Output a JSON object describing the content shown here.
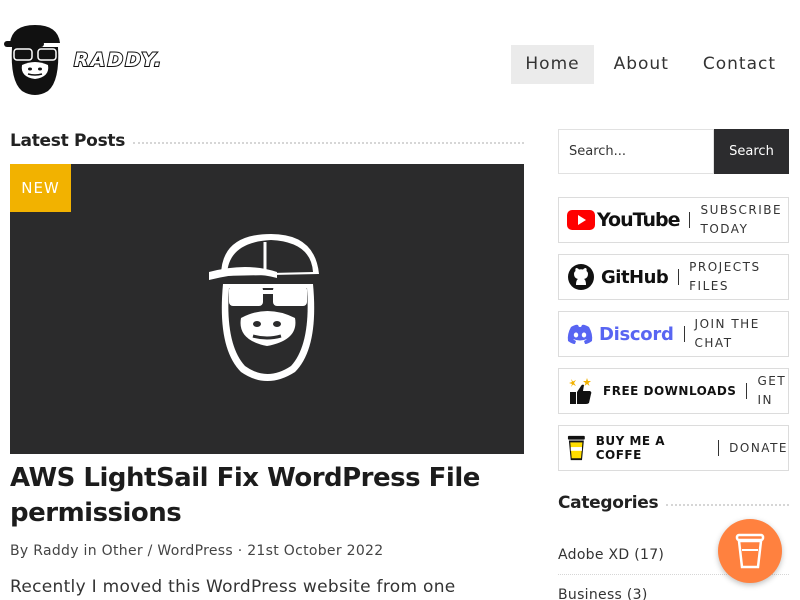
{
  "header": {
    "logo_text": "RADDY.",
    "nav": [
      {
        "label": "Home",
        "active": true
      },
      {
        "label": "About",
        "active": false
      },
      {
        "label": "Contact",
        "active": false
      }
    ]
  },
  "main": {
    "section_title": "Latest Posts",
    "hero_badge": "NEW",
    "post": {
      "title": "AWS LightSail Fix WordPress File permissions",
      "meta": "By Raddy in Other / WordPress · 21st October 2022",
      "excerpt": "Recently I moved this WordPress website from one"
    }
  },
  "sidebar": {
    "search": {
      "placeholder": "Search...",
      "button": "Search"
    },
    "promos": [
      {
        "brand": "YouTube",
        "cta_1": "SUBSCRIBE",
        "cta_2": "TODAY",
        "icon": "youtube-icon"
      },
      {
        "brand": "GitHub",
        "cta_1": "PROJECTS FILES",
        "cta_2": "",
        "icon": "github-icon"
      },
      {
        "brand": "Discord",
        "cta_1": "JOIN THE",
        "cta_2": "CHAT",
        "icon": "discord-icon"
      },
      {
        "brand": "FREE DOWNLOADS",
        "cta_1": "GET",
        "cta_2": "IN",
        "icon": "thumbs-up-icon"
      },
      {
        "brand": "BUY ME A COFFE",
        "cta_1": "DONATE",
        "cta_2": "",
        "icon": "coffee-cup-icon"
      }
    ],
    "categories_title": "Categories",
    "categories": [
      {
        "label": "Adobe XD (17)"
      },
      {
        "label": "Business (3)"
      }
    ]
  },
  "colors": {
    "badge": "#f2b200",
    "hero_bg": "#2b2b2c",
    "search_button": "#2c2c2e",
    "youtube_red": "#ff0000",
    "discord_blurple": "#5865f2",
    "coffee_fab": "#ff813f"
  }
}
